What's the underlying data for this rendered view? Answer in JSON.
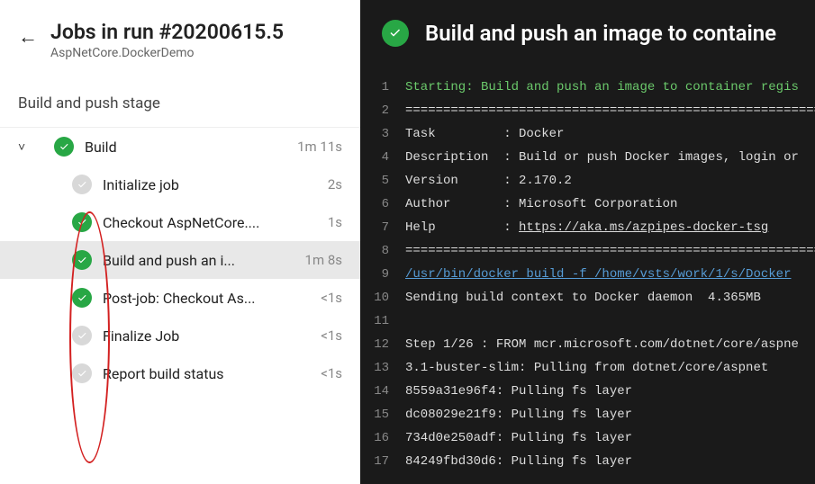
{
  "header": {
    "title": "Jobs in run #20200615.5",
    "subtitle": "AspNetCore.DockerDemo"
  },
  "stage_label": "Build and push stage",
  "job": {
    "name": "Build",
    "duration": "1m 11s"
  },
  "steps": [
    {
      "label": "Initialize job",
      "duration": "2s",
      "status": "muted",
      "selected": false
    },
    {
      "label": "Checkout AspNetCore....",
      "duration": "1s",
      "status": "success",
      "selected": false
    },
    {
      "label": "Build and push an i...",
      "duration": "1m 8s",
      "status": "success",
      "selected": true
    },
    {
      "label": "Post-job: Checkout As...",
      "duration": "<1s",
      "status": "success",
      "selected": false
    },
    {
      "label": "Finalize Job",
      "duration": "<1s",
      "status": "muted",
      "selected": false
    },
    {
      "label": "Report build status",
      "duration": "<1s",
      "status": "muted",
      "selected": false
    }
  ],
  "log_title": "Build and push an image to containe",
  "help_url_text": "https://aka.ms/azpipes-docker-tsg",
  "log_lines": [
    {
      "n": 1,
      "t": "Starting: Build and push an image to container regis",
      "cls": "green"
    },
    {
      "n": 2,
      "t": "==============================================================================",
      "cls": ""
    },
    {
      "n": 3,
      "t": "Task         : Docker",
      "cls": ""
    },
    {
      "n": 4,
      "t": "Description  : Build or push Docker images, login or",
      "cls": ""
    },
    {
      "n": 5,
      "t": "Version      : 2.170.2",
      "cls": ""
    },
    {
      "n": 6,
      "t": "Author       : Microsoft Corporation",
      "cls": ""
    },
    {
      "n": 7,
      "t": "Help         : ",
      "cls": "",
      "link": true
    },
    {
      "n": 8,
      "t": "==============================================================================",
      "cls": ""
    },
    {
      "n": 9,
      "t": "/usr/bin/docker build -f /home/vsts/work/1/s/Docker",
      "cls": "blue"
    },
    {
      "n": 10,
      "t": "Sending build context to Docker daemon  4.365MB",
      "cls": ""
    },
    {
      "n": 11,
      "t": "",
      "cls": ""
    },
    {
      "n": 12,
      "t": "Step 1/26 : FROM mcr.microsoft.com/dotnet/core/aspne",
      "cls": ""
    },
    {
      "n": 13,
      "t": "3.1-buster-slim: Pulling from dotnet/core/aspnet",
      "cls": ""
    },
    {
      "n": 14,
      "t": "8559a31e96f4: Pulling fs layer",
      "cls": ""
    },
    {
      "n": 15,
      "t": "dc08029e21f9: Pulling fs layer",
      "cls": ""
    },
    {
      "n": 16,
      "t": "734d0e250adf: Pulling fs layer",
      "cls": ""
    },
    {
      "n": 17,
      "t": "84249fbd30d6: Pulling fs layer",
      "cls": ""
    }
  ]
}
